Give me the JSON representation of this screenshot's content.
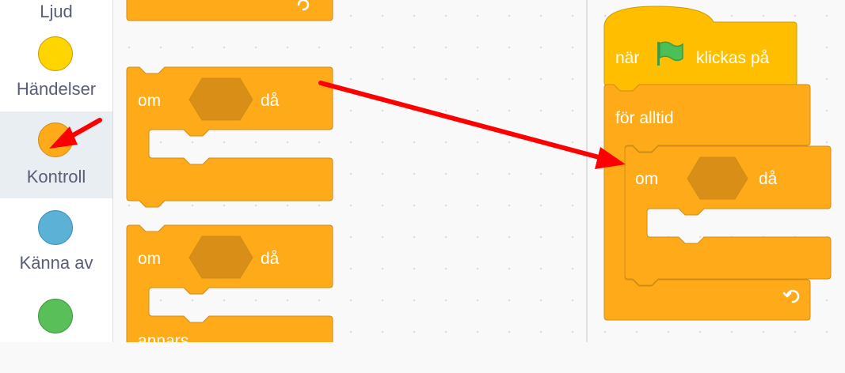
{
  "sidebar": {
    "categories": [
      {
        "label": "Ljud",
        "color": "#CF63CF"
      },
      {
        "label": "Händelser",
        "color": "#FFD500"
      },
      {
        "label": "Kontroll",
        "color": "#FFAB19"
      },
      {
        "label": "Känna av",
        "color": "#5CB1D6"
      },
      {
        "label": "",
        "color": "#59C059"
      }
    ],
    "active": "Kontroll"
  },
  "palette": {
    "if_block_1": {
      "keyword": "om",
      "then": "då"
    },
    "if_else_block": {
      "keyword": "om",
      "then": "då",
      "else": "annars"
    }
  },
  "script": {
    "hat": {
      "before": "när",
      "after": "klickas på"
    },
    "forever": {
      "label": "för alltid"
    },
    "if_block": {
      "keyword": "om",
      "then": "då"
    }
  },
  "colors": {
    "control": "#FFAB19",
    "control_border": "#CF8B17",
    "events": "#FFBF00",
    "events_border": "#CC9900",
    "arrow": "#FF0000",
    "flag": "#4CBF56"
  }
}
